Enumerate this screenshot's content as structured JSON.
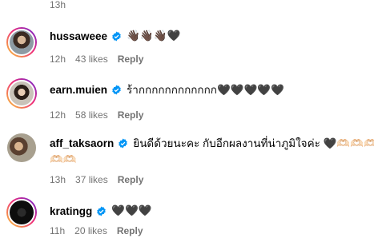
{
  "top_timestamp": "13h",
  "comments": [
    {
      "username": "hussaweee",
      "text": "👋🏿👋🏿👋🏿🖤",
      "time": "12h",
      "likes": "43 likes",
      "reply": "Reply"
    },
    {
      "username": "earn.muien",
      "text": "ร้ากกกกกกกกกกกก🖤🖤🖤🖤🖤",
      "time": "12h",
      "likes": "58 likes",
      "reply": "Reply"
    },
    {
      "username": "aff_taksaorn",
      "text_line1": "ยินดีด้วยนะคะ กับอีกผลงานที่น่าภูมิใจค่ะ 🖤🫶🏻🫶🏻🫶🏻🫶🏻",
      "text_line2": "🫶🏻🫶🏻",
      "time": "13h",
      "likes": "37 likes",
      "reply": "Reply"
    },
    {
      "username": "kratingg",
      "text": "🖤🖤🖤",
      "time": "11h",
      "likes": "20 likes",
      "reply": "Reply"
    }
  ],
  "colors": {
    "verified": "#0095f6",
    "meta": "#737373"
  },
  "icons": {
    "verified": "verified-badge-icon"
  }
}
